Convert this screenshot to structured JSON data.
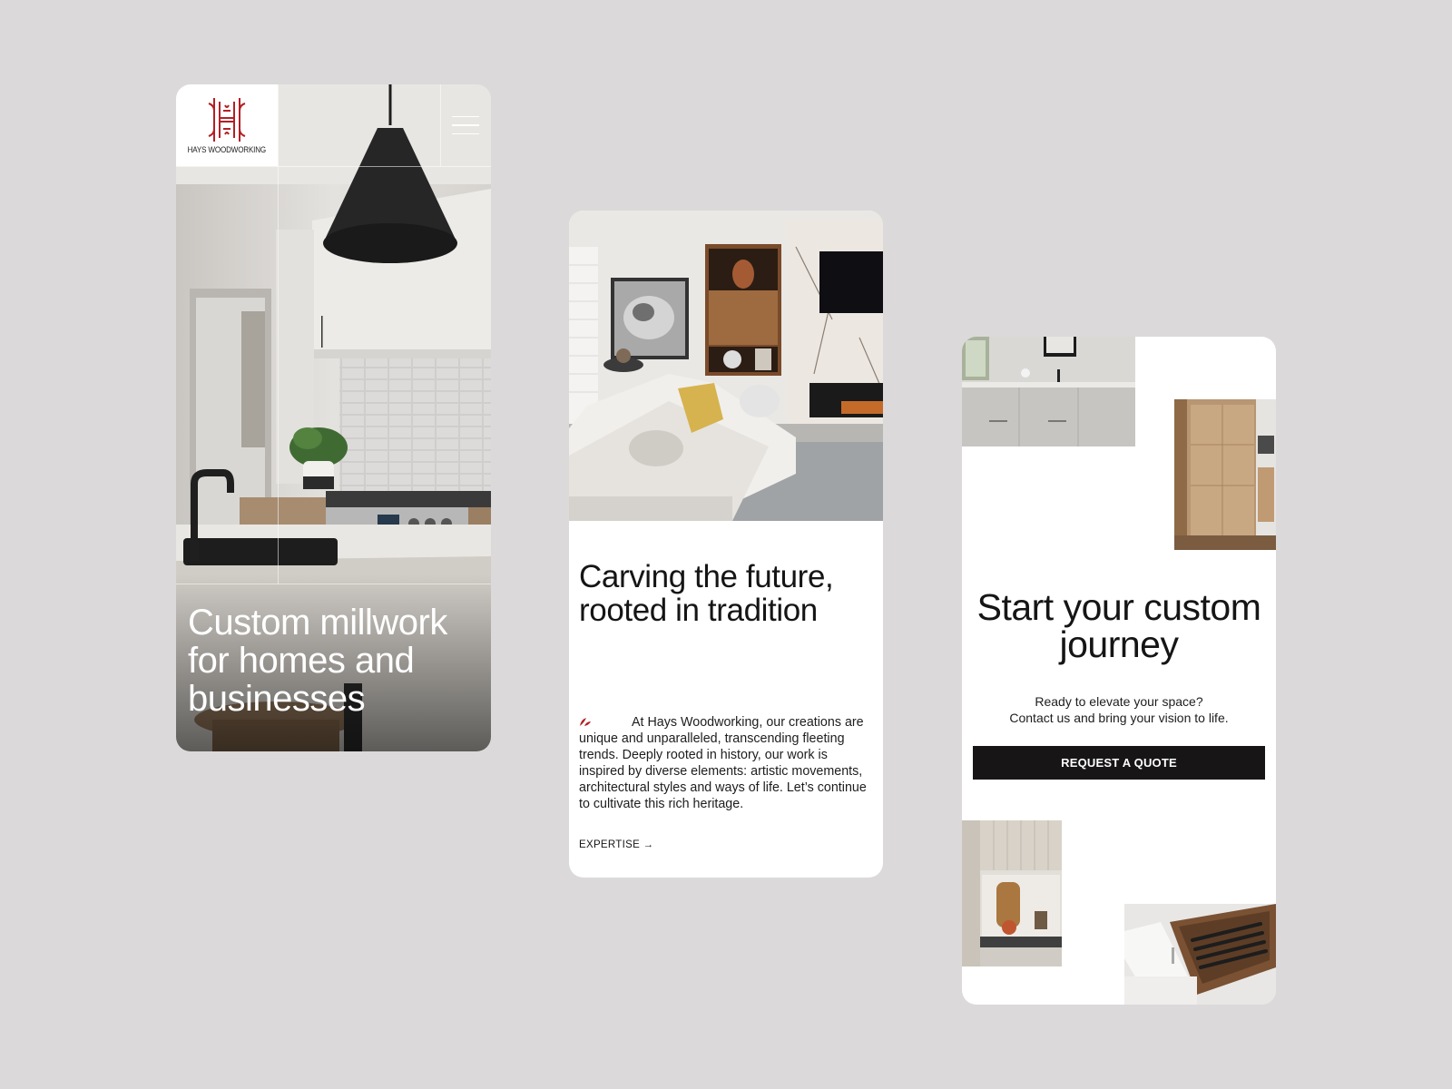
{
  "card1": {
    "brand_name": "HAYS WOODWORKING",
    "logo_icon": "hays-monogram-logo",
    "menu_icon": "hamburger-menu-icon",
    "hero_title": "Custom millwork for homes and businesses",
    "image": "kitchen-with-black-pendant-lamp"
  },
  "card2": {
    "image": "living-room-with-white-sofa",
    "title": "Carving the future, rooted in tradition",
    "body": "At Hays Woodworking, our creations are unique and unparalleled, transcending fleeting trends. Deeply rooted in history, our work is inspired by diverse elements: artistic movements, architectural styles and ways of life. Let’s continue to cultivate this rich heritage.",
    "link_label": "EXPERTISE →",
    "leaf_icon": "red-leaf-icon"
  },
  "card3": {
    "title": "Start your custom journey",
    "subtitle_line1": "Ready to elevate your space?",
    "subtitle_line2": "Contact us and bring your vision to life.",
    "cta_label": "REQUEST A QUOTE",
    "images": [
      "bathroom-vanity",
      "wood-panel-cabinets",
      "kitchen-shelf-with-cutting-board",
      "knife-drawer"
    ]
  },
  "colors": {
    "background": "#dbd9da",
    "brand_red": "#b32025",
    "cta_bg": "#171516",
    "text": "#151515"
  }
}
